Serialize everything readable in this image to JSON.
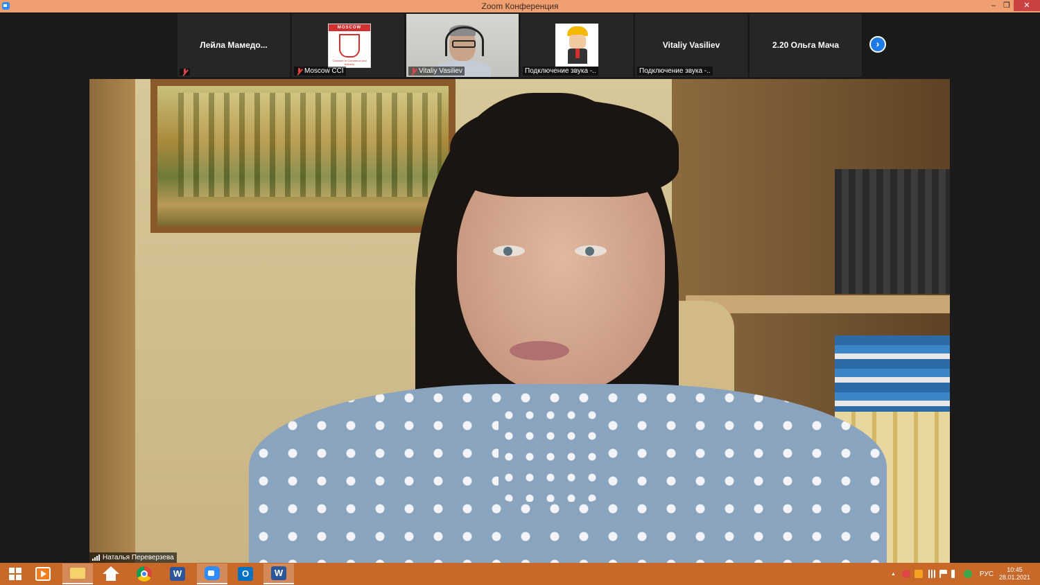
{
  "window": {
    "title": "Zoom Конференция",
    "minimize_glyph": "–",
    "maximize_glyph": "❐",
    "close_glyph": "✕"
  },
  "participants_strip": {
    "tiles": [
      {
        "center_name": "Лейла  Мамедо...",
        "label": "",
        "muted": true,
        "kind": "name-only"
      },
      {
        "center_name": "",
        "label": "Moscow CCI",
        "muted": true,
        "kind": "logo",
        "logo_band": "MOSCOW",
        "logo_caption": "Chamber of Commerce and Industry"
      },
      {
        "center_name": "",
        "label": "Vitaliy Vasiliev",
        "muted": true,
        "kind": "video"
      },
      {
        "center_name": "",
        "label": "Подключение звука -..",
        "muted": false,
        "kind": "cartoon"
      },
      {
        "center_name": "Vitaliy Vasiliev",
        "label": "Подключение звука -..",
        "muted": false,
        "kind": "name-only"
      },
      {
        "center_name": "2.20 Ольга Мача",
        "label": "",
        "muted": false,
        "kind": "name-only"
      }
    ],
    "next_glyph": "›"
  },
  "main_speaker": {
    "name": "Наталья Переверзева"
  },
  "taskbar": {
    "word_glyph": "W",
    "outlook_glyph": "O",
    "language": "РУС",
    "time": "10:45",
    "date": "28.01.2021",
    "tray_up_glyph": "▲"
  },
  "colors": {
    "titlebar": "#f0a070",
    "taskbar": "#c8692a",
    "accent": "#2d8cff",
    "muted_mic": "#e04646"
  }
}
